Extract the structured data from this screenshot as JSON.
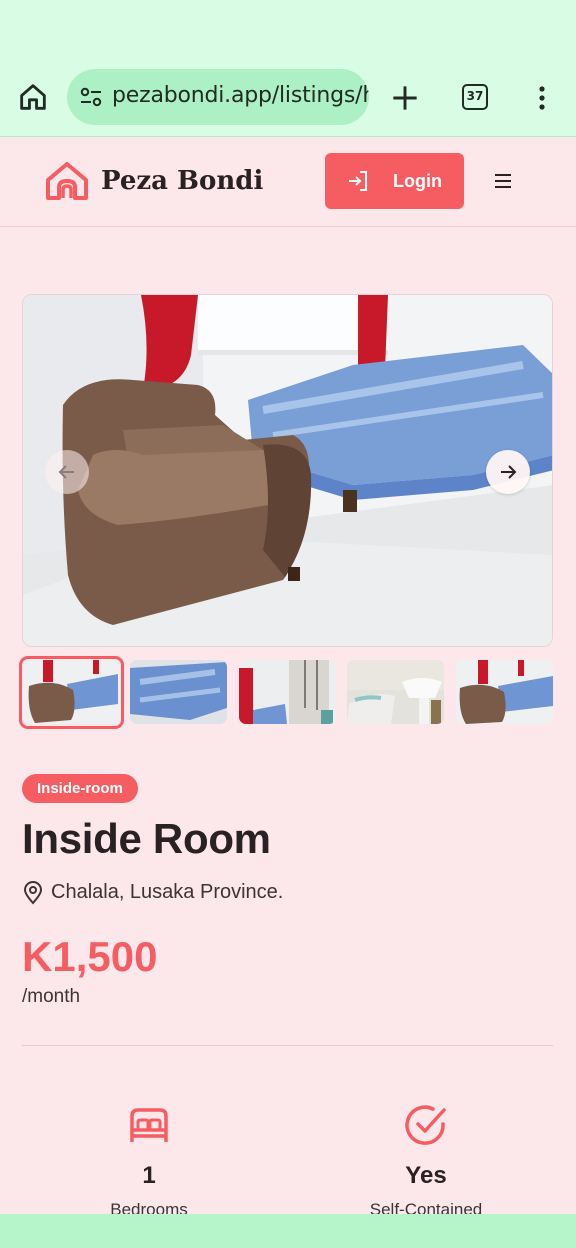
{
  "browser": {
    "url": "pezabondi.app/listings/h",
    "tab_count": "37",
    "icons": {
      "home": "home-icon",
      "site_settings": "tune-icon",
      "new_tab": "plus-icon",
      "tabs": "tabs-icon",
      "menu": "kebab-menu-icon"
    }
  },
  "site": {
    "brand": "Peza Bondi",
    "login_label": "Login",
    "accent_color": "#f55d62"
  },
  "gallery": {
    "thumbnails": [
      "room-sofa-bed",
      "bed-closeup",
      "room-window",
      "bathroom",
      "room-sofa-bed"
    ],
    "active_index": 0
  },
  "listing": {
    "category": "Inside-room",
    "title": "Inside Room",
    "location": "Chalala, Lusaka Province.",
    "price": "K1,500",
    "period": "/month"
  },
  "features": [
    {
      "icon": "bed-icon",
      "value": "1",
      "label": "Bedrooms"
    },
    {
      "icon": "check-circle-icon",
      "value": "Yes",
      "label": "Self-Contained"
    }
  ]
}
